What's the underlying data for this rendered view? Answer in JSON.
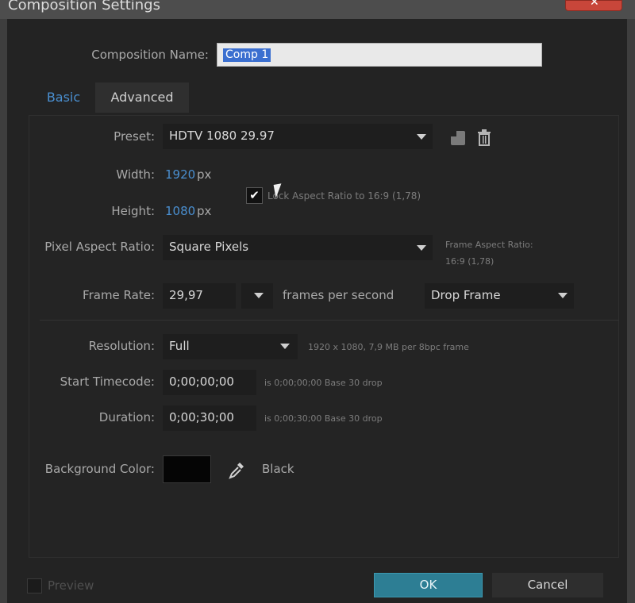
{
  "window": {
    "title": "Composition Settings",
    "close_glyph": "✕"
  },
  "composition_name": {
    "label": "Composition Name:",
    "value": "Comp 1"
  },
  "tabs": [
    {
      "label": "Basic"
    },
    {
      "label": "Advanced"
    }
  ],
  "preset": {
    "label": "Preset:",
    "value": "HDTV 1080 29.97"
  },
  "width": {
    "label": "Width:",
    "value": "1920",
    "unit": "px"
  },
  "height": {
    "label": "Height:",
    "value": "1080",
    "unit": "px"
  },
  "lock_aspect": {
    "label": "Lock Aspect Ratio to 16:9 (1,78)",
    "checked": true,
    "check_glyph": "✔"
  },
  "pixel_aspect": {
    "label": "Pixel Aspect Ratio:",
    "value": "Square Pixels"
  },
  "frame_aspect": {
    "label": "Frame Aspect Ratio:",
    "value": "16:9 (1,78)"
  },
  "frame_rate": {
    "label": "Frame Rate:",
    "value": "29,97",
    "unit_label": "frames per second",
    "drop_value": "Drop Frame"
  },
  "resolution": {
    "label": "Resolution:",
    "value": "Full",
    "info": "1920 x 1080, 7,9 MB per 8bpc frame"
  },
  "start_timecode": {
    "label": "Start Timecode:",
    "value": "0;00;00;00",
    "info": "is 0;00;00;00  Base 30  drop"
  },
  "duration": {
    "label": "Duration:",
    "value": "0;00;30;00",
    "info": "is 0;00;30;00  Base 30  drop"
  },
  "background": {
    "label": "Background Color:",
    "color": "#050505",
    "name": "Black"
  },
  "footer": {
    "preview_label": "Preview",
    "ok_label": "OK",
    "cancel_label": "Cancel"
  },
  "colors": {
    "accent_blue": "#4a8fd0",
    "ok_button": "#2d7e94",
    "dialog_bg": "#232323",
    "close_red": "#c8463a"
  }
}
